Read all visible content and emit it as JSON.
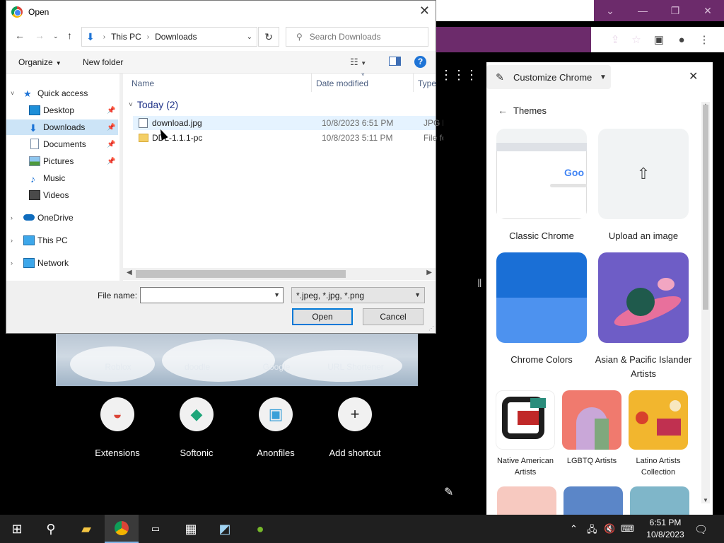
{
  "dialog": {
    "title": "Open",
    "breadcrumb": [
      "This PC",
      "Downloads"
    ],
    "search_placeholder": "Search Downloads",
    "toolbar": {
      "organize": "Organize",
      "new_folder": "New folder"
    },
    "nav_items": [
      {
        "label": "Quick access",
        "expander": "˅",
        "pinned": false
      },
      {
        "label": "Desktop",
        "pinned": true
      },
      {
        "label": "Downloads",
        "pinned": true,
        "selected": true
      },
      {
        "label": "Documents",
        "pinned": true
      },
      {
        "label": "Pictures",
        "pinned": true
      },
      {
        "label": "Music",
        "pinned": false
      },
      {
        "label": "Videos",
        "pinned": false
      },
      {
        "label": "OneDrive",
        "expander": "›"
      },
      {
        "label": "This PC",
        "expander": "›"
      },
      {
        "label": "Network",
        "expander": "›"
      }
    ],
    "columns": [
      "Name",
      "Date modified",
      "Type"
    ],
    "group_label": "Today (2)",
    "files": [
      {
        "name": "download.jpg",
        "date": "10/8/2023 6:51 PM",
        "type": "JPG F"
      },
      {
        "name": "DDL-1.1.1-pc",
        "date": "10/8/2023 5:11 PM",
        "type": "File fo"
      }
    ],
    "file_name_label": "File name:",
    "file_name_value": "",
    "file_type": "*.jpeg, *.jpg, *.png",
    "open_label": "Open",
    "cancel_label": "Cancel"
  },
  "ntp": {
    "faded_shortcuts": [
      "Roblox",
      "doodle",
      "Google",
      "URL Shortener"
    ],
    "shortcuts": [
      {
        "label": "Extensions",
        "icon": "chrome-icon"
      },
      {
        "label": "Softonic",
        "icon": "softonic-icon"
      },
      {
        "label": "Anonfiles",
        "icon": "anonfiles-icon"
      },
      {
        "label": "Add shortcut",
        "icon": "plus-icon"
      }
    ]
  },
  "panel": {
    "title": "Customize Chrome",
    "section": "Themes",
    "themes": [
      {
        "label": "Classic Chrome"
      },
      {
        "label": "Upload an image"
      },
      {
        "label": "Chrome Colors"
      },
      {
        "label": "Asian & Pacific Islander Artists"
      },
      {
        "label": "Native American Artists"
      },
      {
        "label": "LGBTQ Artists"
      },
      {
        "label": "Latino Artists Collection"
      }
    ],
    "classic_preview_text": "Goo"
  },
  "taskbar": {
    "apps": [
      "start",
      "search",
      "file-explorer",
      "chrome",
      "terminal",
      "calculator",
      "notepad",
      "utorrent"
    ],
    "time": "6:51 PM",
    "date": "10/8/2023"
  },
  "colors": {
    "chrome_frame": "#6c2b6b",
    "selection": "#cce4f7",
    "accent": "#0078d7"
  }
}
